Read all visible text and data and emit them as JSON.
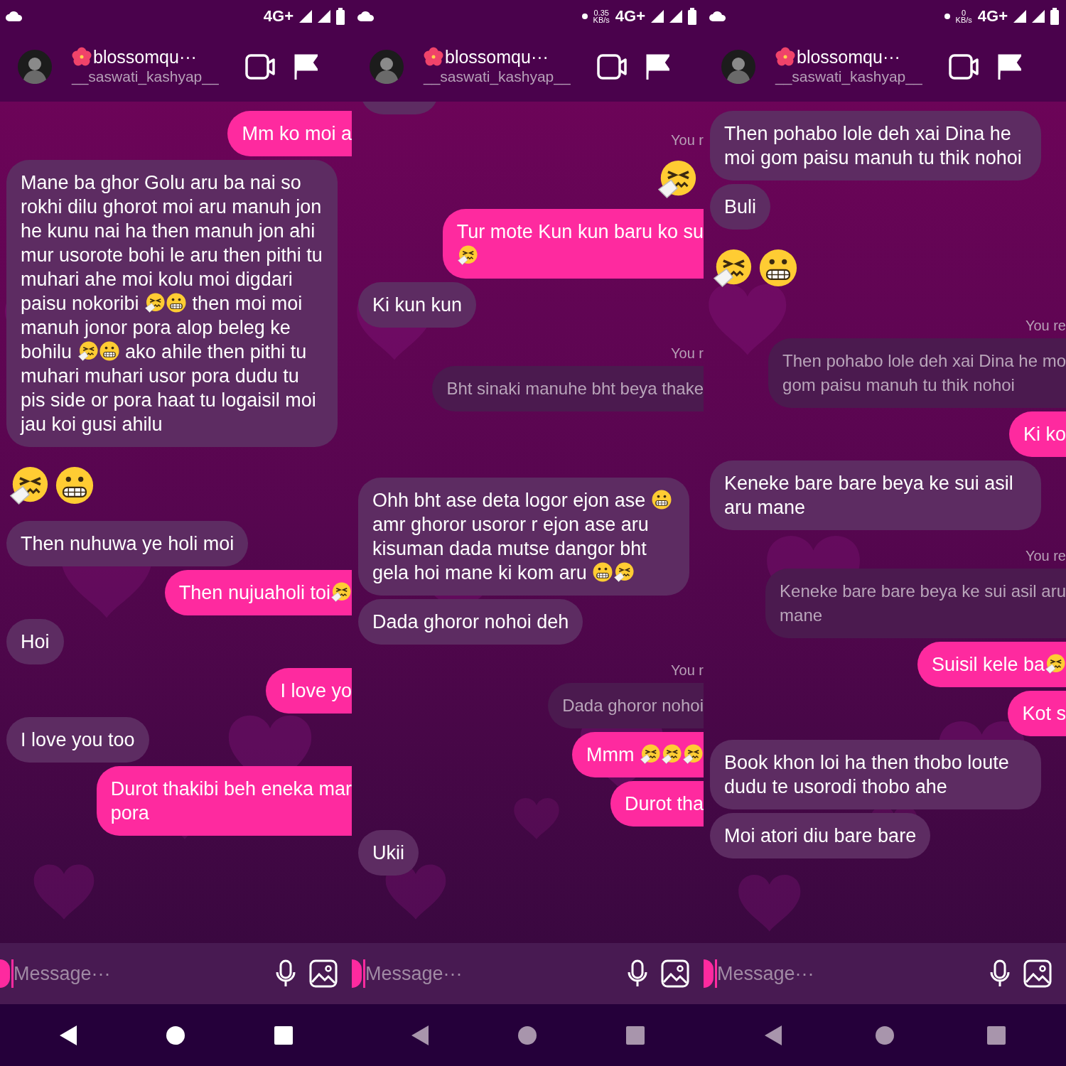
{
  "panels": [
    {
      "status_bar": {
        "notification_dot": false,
        "network": "4G+"
      },
      "header": {
        "name": "blossomqu···",
        "username": "__saswati_kashyap__"
      },
      "messages": [
        {
          "kind": "outgoing",
          "parts": [
            {
              "kind": "text",
              "text": "Mm ko moi a"
            }
          ]
        },
        {
          "kind": "incoming",
          "parts": [
            {
              "kind": "text",
              "text": "Mane ba ghor Golu aru ba nai so rokhi dilu ghorot moi aru manuh jon he kunu nai ha then manuh jon ahi mur usorote bohi le aru then pithi tu muhari ahe moi kolu moi digdari paisu nokoribi "
            },
            {
              "kind": "sneezing-face"
            },
            {
              "kind": "grimacing-face"
            },
            {
              "kind": "text",
              "text": " then moi moi manuh jonor pora alop beleg ke bohilu "
            },
            {
              "kind": "sneezing-face"
            },
            {
              "kind": "grimacing-face"
            },
            {
              "kind": "text",
              "text": " ako ahile then pithi tu muhari muhari usor pora dudu tu pis side or pora haat tu logaisil moi jau koi gusi ahilu"
            }
          ]
        },
        {
          "kind": "emoji-in",
          "parts": [
            {
              "kind": "sneezing-face"
            },
            {
              "kind": "grimacing-face"
            }
          ]
        },
        {
          "kind": "incoming",
          "parts": [
            {
              "kind": "text",
              "text": "Then nuhuwa ye holi moi"
            }
          ]
        },
        {
          "kind": "outgoing",
          "parts": [
            {
              "kind": "text",
              "text": "Then nujuaholi toi"
            },
            {
              "kind": "sneezing-face"
            }
          ]
        },
        {
          "kind": "incoming",
          "parts": [
            {
              "kind": "text",
              "text": "Hoi"
            }
          ]
        },
        {
          "kind": "outgoing",
          "parts": [
            {
              "kind": "text",
              "text": "I love yo"
            }
          ]
        },
        {
          "kind": "incoming",
          "parts": [
            {
              "kind": "text",
              "text": "I love you too"
            }
          ]
        },
        {
          "kind": "outgoing",
          "parts": [
            {
              "kind": "text",
              "text": "Durot thakibi beh eneka mar\npora"
            }
          ]
        }
      ],
      "composer": {
        "placeholder": "Message···"
      },
      "nav_dimmed": false
    },
    {
      "status_bar": {
        "notification_dot": true,
        "speed_value": "0.35",
        "speed_unit": "KB/s",
        "network": "4G+"
      },
      "header": {
        "name": "blossomqu···",
        "username": "__saswati_kashyap__"
      },
      "messages": [
        {
          "kind": "cut-bubble"
        },
        {
          "kind": "reply-label",
          "parts": [
            {
              "kind": "text",
              "text": "You r"
            }
          ]
        },
        {
          "kind": "emoji-out",
          "parts": [
            {
              "kind": "sneezing-face"
            }
          ]
        },
        {
          "kind": "outgoing",
          "parts": [
            {
              "kind": "text",
              "text": "Tur mote Kun kun baru ko su\n"
            },
            {
              "kind": "sneezing-face"
            }
          ]
        },
        {
          "kind": "incoming",
          "parts": [
            {
              "kind": "text",
              "text": "Ki kun kun"
            }
          ]
        },
        {
          "kind": "reply-label",
          "parts": [
            {
              "kind": "text",
              "text": "You r"
            }
          ]
        },
        {
          "kind": "quote",
          "parts": [
            {
              "kind": "text",
              "text": "Bht sinaki manuhe bht beya thake"
            }
          ]
        },
        {
          "kind": "incoming",
          "parts": [
            {
              "kind": "text",
              "text": "Ohh bht ase deta logor ejon ase "
            },
            {
              "kind": "grimacing-face"
            },
            {
              "kind": "text",
              "text": " amr ghoror usoror r ejon ase aru kisuman dada mutse dangor bht gela hoi mane ki kom aru "
            },
            {
              "kind": "grimacing-face"
            },
            {
              "kind": "sneezing-face"
            }
          ]
        },
        {
          "kind": "incoming",
          "parts": [
            {
              "kind": "text",
              "text": "Dada ghoror nohoi deh"
            }
          ]
        },
        {
          "kind": "reply-label",
          "parts": [
            {
              "kind": "text",
              "text": "You r"
            }
          ]
        },
        {
          "kind": "quote",
          "parts": [
            {
              "kind": "text",
              "text": "Dada ghoror nohoi"
            }
          ]
        },
        {
          "kind": "outgoing",
          "parts": [
            {
              "kind": "text",
              "text": "Mmm "
            },
            {
              "kind": "sneezing-face"
            },
            {
              "kind": "sneezing-face"
            },
            {
              "kind": "sneezing-face"
            }
          ]
        },
        {
          "kind": "outgoing",
          "parts": [
            {
              "kind": "text",
              "text": "Durot tha"
            }
          ]
        },
        {
          "kind": "incoming",
          "parts": [
            {
              "kind": "text",
              "text": "Ukii"
            }
          ]
        }
      ],
      "composer": {
        "placeholder": "Message···"
      },
      "nav_dimmed": true
    },
    {
      "status_bar": {
        "notification_dot": true,
        "speed_value": "0",
        "speed_unit": "KB/s",
        "network": "4G+"
      },
      "header": {
        "name": "blossomqu···",
        "username": "__saswati_kashyap__"
      },
      "messages": [
        {
          "kind": "incoming",
          "parts": [
            {
              "kind": "text",
              "text": "Then pohabo lole deh xai Dina he moi gom paisu manuh tu thik nohoi"
            }
          ]
        },
        {
          "kind": "incoming",
          "parts": [
            {
              "kind": "text",
              "text": "Buli"
            }
          ]
        },
        {
          "kind": "emoji-in",
          "parts": [
            {
              "kind": "sneezing-face"
            },
            {
              "kind": "grimacing-face"
            }
          ]
        },
        {
          "kind": "reply-label",
          "parts": [
            {
              "kind": "text",
              "text": "You re"
            }
          ]
        },
        {
          "kind": "quote",
          "parts": [
            {
              "kind": "text",
              "text": "Then pohabo lole deh xai Dina he mo\ngom paisu manuh tu thik nohoi"
            }
          ]
        },
        {
          "kind": "outgoing",
          "parts": [
            {
              "kind": "text",
              "text": "Ki ko"
            }
          ]
        },
        {
          "kind": "incoming",
          "parts": [
            {
              "kind": "text",
              "text": "Keneke bare bare beya ke sui asil aru mane"
            }
          ]
        },
        {
          "kind": "reply-label",
          "parts": [
            {
              "kind": "text",
              "text": "You re"
            }
          ]
        },
        {
          "kind": "quote",
          "parts": [
            {
              "kind": "text",
              "text": "Keneke bare bare beya ke sui asil aru\nmane"
            }
          ]
        },
        {
          "kind": "outgoing",
          "parts": [
            {
              "kind": "text",
              "text": "Suisil kele ba"
            },
            {
              "kind": "sneezing-face"
            }
          ]
        },
        {
          "kind": "outgoing",
          "parts": [
            {
              "kind": "text",
              "text": "Kot s"
            }
          ]
        },
        {
          "kind": "incoming",
          "parts": [
            {
              "kind": "text",
              "text": "Book khon loi ha then thobo loute dudu te usorodi thobo ahe"
            }
          ]
        },
        {
          "kind": "incoming",
          "parts": [
            {
              "kind": "text",
              "text": "Moi atori diu bare bare"
            }
          ]
        }
      ],
      "composer": {
        "placeholder": "Message···"
      },
      "nav_dimmed": true
    }
  ]
}
